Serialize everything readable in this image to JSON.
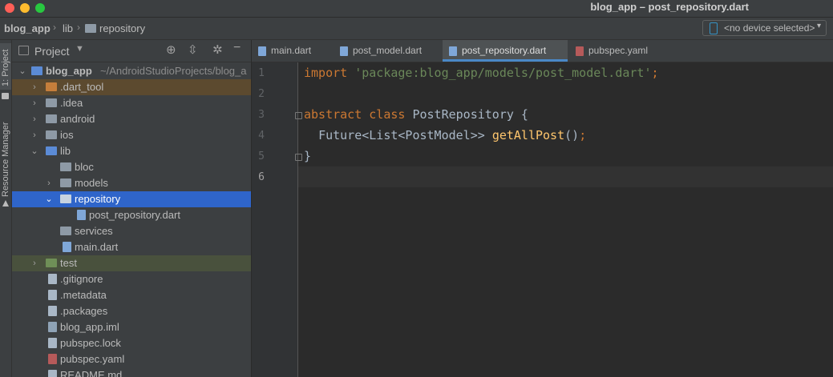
{
  "window": {
    "title": "blog_app – post_repository.dart"
  },
  "navbar": {
    "breadcrumbs": [
      "blog_app",
      "lib",
      "repository"
    ],
    "device_select": "<no device selected>"
  },
  "left_strip": {
    "project_tab": "1: Project",
    "resource_manager_tab": "Resource Manager"
  },
  "project_panel": {
    "view_label": "Project",
    "root_name": "blog_app",
    "root_path": "~/AndroidStudioProjects/blog_a",
    "items": [
      {
        "label": ".dart_tool",
        "kind": "folder"
      },
      {
        "label": ".idea",
        "kind": "folder"
      },
      {
        "label": "android",
        "kind": "folder"
      },
      {
        "label": "ios",
        "kind": "folder"
      },
      {
        "label": "lib",
        "kind": "folder"
      },
      {
        "label": "bloc",
        "kind": "folder"
      },
      {
        "label": "models",
        "kind": "folder"
      },
      {
        "label": "repository",
        "kind": "folder"
      },
      {
        "label": "post_repository.dart",
        "kind": "dart"
      },
      {
        "label": "services",
        "kind": "folder"
      },
      {
        "label": "main.dart",
        "kind": "dart"
      },
      {
        "label": "test",
        "kind": "folder"
      },
      {
        "label": ".gitignore",
        "kind": "file"
      },
      {
        "label": ".metadata",
        "kind": "file"
      },
      {
        "label": ".packages",
        "kind": "file"
      },
      {
        "label": "blog_app.iml",
        "kind": "iml"
      },
      {
        "label": "pubspec.lock",
        "kind": "file"
      },
      {
        "label": "pubspec.yaml",
        "kind": "yaml"
      },
      {
        "label": "README.md",
        "kind": "file"
      }
    ]
  },
  "editor_tabs": [
    {
      "label": "main.dart",
      "active": false
    },
    {
      "label": "post_model.dart",
      "active": false
    },
    {
      "label": "post_repository.dart",
      "active": true
    },
    {
      "label": "pubspec.yaml",
      "active": false
    }
  ],
  "editor": {
    "line_numbers": [
      "1",
      "2",
      "3",
      "4",
      "5",
      "6"
    ],
    "line1": {
      "kw": "import",
      "str": "'package:blog_app/models/post_model.dart'",
      "end": ";"
    },
    "line3": {
      "kw": "abstract class",
      "name": "PostRepository {"
    },
    "line4": {
      "type": "Future<List<PostModel>>",
      "fn": "getAllPost",
      "end": "();"
    },
    "line5": {
      "text": "}"
    }
  },
  "colors": {
    "accent": "#2f65ca",
    "keyword": "#cc7832",
    "string": "#6a8759",
    "function": "#ffc66d"
  }
}
